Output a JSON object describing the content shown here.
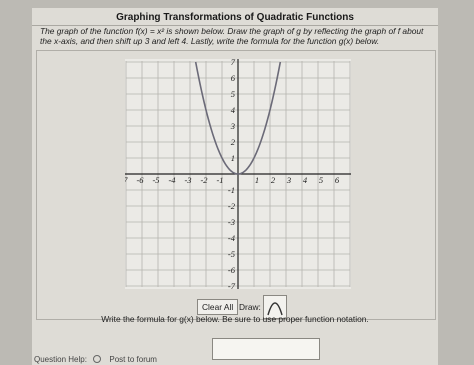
{
  "header": {
    "title": "Graphing Transformations of Quadratic Functions"
  },
  "problem": {
    "text": "The graph of the function f(x) = x² is shown below. Draw the graph of g by reflecting the graph of f about the x-axis, and then shift up 3 and left 4. Lastly, write the formula for the function g(x) below."
  },
  "graph": {
    "x_tick_labels": [
      "-7",
      "-6",
      "-5",
      "-4",
      "-3",
      "-2",
      "-1",
      "1",
      "2",
      "3",
      "4",
      "5",
      "6",
      "7"
    ],
    "y_tick_labels": [
      "7",
      "6",
      "5",
      "4",
      "3",
      "2",
      "1",
      "-1",
      "-2",
      "-3",
      "-4",
      "-5",
      "-6",
      "-7"
    ],
    "x_range": [
      -7,
      7
    ],
    "y_range": [
      -7,
      7
    ],
    "grid": true,
    "curve": {
      "function": "x^2",
      "color": "#6b6a78"
    }
  },
  "controls": {
    "clear_label": "Clear All",
    "draw_label": "Draw:",
    "draw_tool_icon": "parabola-tool-icon"
  },
  "formula": {
    "prompt": "Write the formula for g(x) below. Be sure to use proper function notation.",
    "answer_value": ""
  },
  "footer": {
    "help_label": "Question Help:",
    "post_label": "Post to forum"
  }
}
